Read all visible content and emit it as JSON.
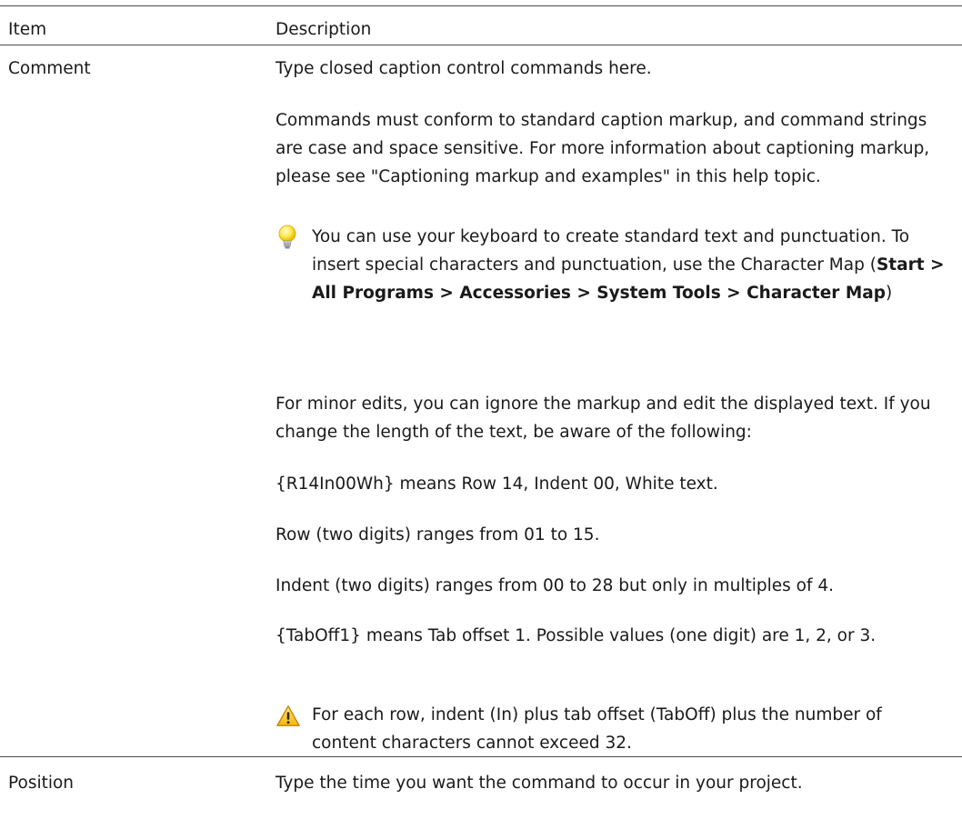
{
  "table": {
    "headers": {
      "item": "Item",
      "description": "Description"
    },
    "rows": [
      {
        "item": "Comment",
        "paragraphs": [
          "Type closed caption control commands here.",
          "Commands must conform to standard caption markup, and command strings are case and space sensitive. For more information about captioning markup, please see \"Captioning markup and examples\" in this help topic."
        ],
        "tip": {
          "icon": "lightbulb-icon",
          "text_before": "You can use your keyboard to create standard text and punctuation. To insert special characters and punctuation, use the Character Map (",
          "path": "Start > All Programs > Accessories > System Tools > Character Map",
          "text_after": ")"
        },
        "paragraphs_after": [
          "For minor edits, you can ignore the markup and edit the displayed text. If you change the length of the text, be aware of the following:",
          "{R14In00Wh} means Row 14, Indent 00, White text.",
          "Row (two digits) ranges from 01 to 15.",
          "Indent (two digits) ranges from 00 to 28 but only in multiples of 4.",
          "{TabOff1} means Tab offset 1. Possible values (one digit) are 1, 2, or 3."
        ],
        "warning": {
          "icon": "warning-icon",
          "text": "For each row, indent (In) plus tab offset (TabOff) plus the number of content characters cannot exceed 32."
        }
      },
      {
        "item": "Position",
        "paragraphs": [
          "Type the time you want the command to occur in your project."
        ]
      }
    ]
  }
}
